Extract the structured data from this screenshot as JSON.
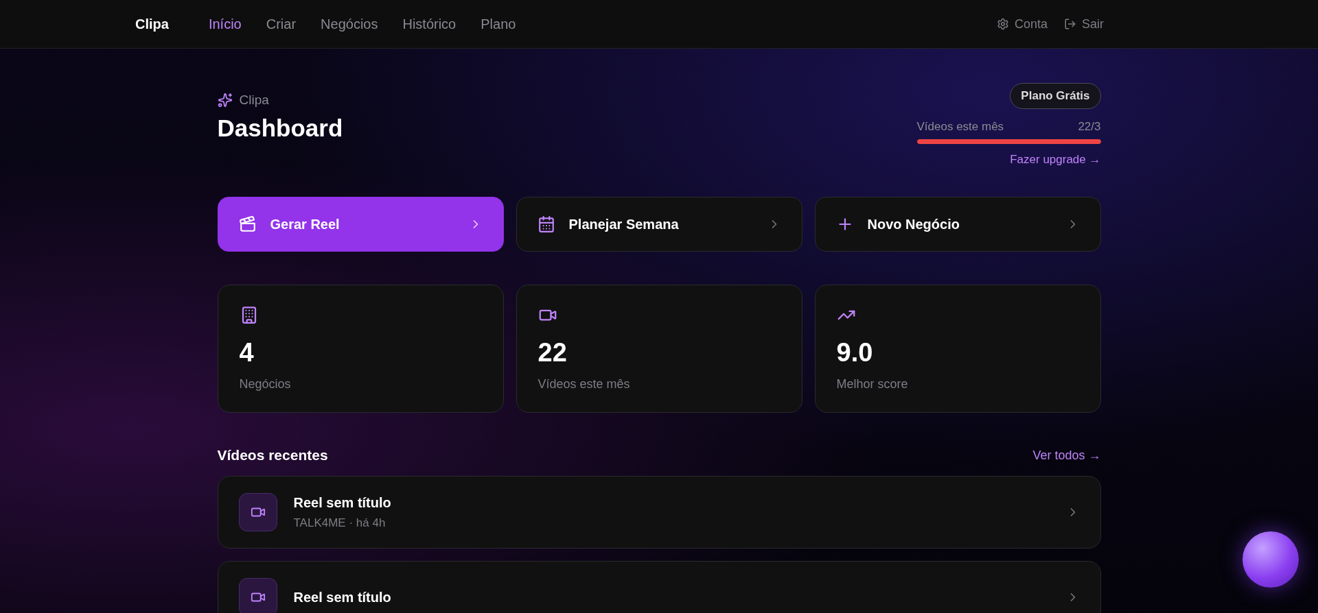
{
  "nav": {
    "brand": "Clipa",
    "items": [
      {
        "label": "Início",
        "selected": true
      },
      {
        "label": "Criar",
        "selected": false
      },
      {
        "label": "Negócios",
        "selected": false
      },
      {
        "label": "Histórico",
        "selected": false
      },
      {
        "label": "Plano",
        "selected": false
      }
    ],
    "account": "Conta",
    "logout": "Sair"
  },
  "header": {
    "eyebrow": "Clipa",
    "title": "Dashboard",
    "plan_badge": "Plano Grátis",
    "usage": {
      "label": "Vídeos este mês",
      "reading": "22/3",
      "level": 1
    },
    "upgrade_link": "Fazer upgrade →"
  },
  "actions": [
    {
      "kind": "reel",
      "label": "Gerar Reel",
      "selected": true
    },
    {
      "kind": "calendar",
      "label": "Planejar Semana",
      "selected": false
    },
    {
      "kind": "plus",
      "label": "Novo Negócio",
      "selected": false
    }
  ],
  "stats": [
    {
      "kind": "building",
      "value": "4",
      "label": "Negócios"
    },
    {
      "kind": "video",
      "value": "22",
      "label": "Vídeos este mês"
    },
    {
      "kind": "trend",
      "value": "9.0",
      "label": "Melhor score"
    }
  ],
  "recent": {
    "title": "Vídeos recentes",
    "link": "Ver todos →",
    "items": [
      {
        "title": "Reel sem título",
        "meta": "TALK4ME · há 4h"
      },
      {
        "title": "Reel sem título"
      }
    ]
  }
}
